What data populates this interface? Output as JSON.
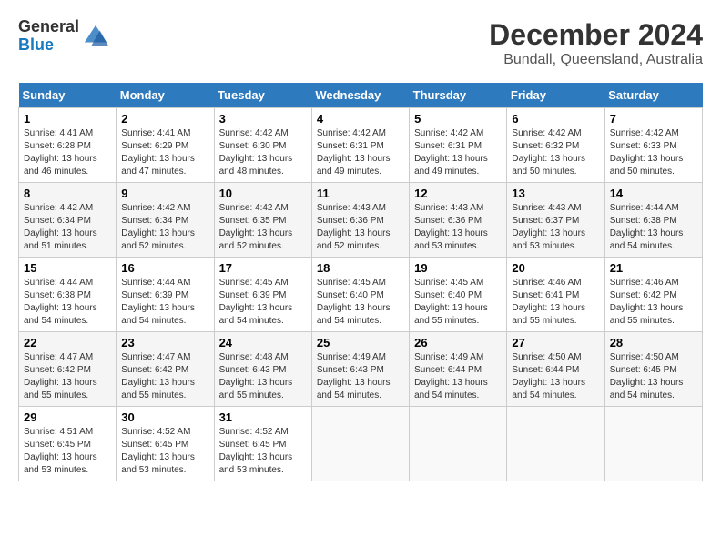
{
  "logo": {
    "general": "General",
    "blue": "Blue"
  },
  "title": "December 2024",
  "location": "Bundall, Queensland, Australia",
  "days_header": [
    "Sunday",
    "Monday",
    "Tuesday",
    "Wednesday",
    "Thursday",
    "Friday",
    "Saturday"
  ],
  "weeks": [
    [
      {
        "day": "1",
        "info": "Sunrise: 4:41 AM\nSunset: 6:28 PM\nDaylight: 13 hours\nand 46 minutes."
      },
      {
        "day": "2",
        "info": "Sunrise: 4:41 AM\nSunset: 6:29 PM\nDaylight: 13 hours\nand 47 minutes."
      },
      {
        "day": "3",
        "info": "Sunrise: 4:42 AM\nSunset: 6:30 PM\nDaylight: 13 hours\nand 48 minutes."
      },
      {
        "day": "4",
        "info": "Sunrise: 4:42 AM\nSunset: 6:31 PM\nDaylight: 13 hours\nand 49 minutes."
      },
      {
        "day": "5",
        "info": "Sunrise: 4:42 AM\nSunset: 6:31 PM\nDaylight: 13 hours\nand 49 minutes."
      },
      {
        "day": "6",
        "info": "Sunrise: 4:42 AM\nSunset: 6:32 PM\nDaylight: 13 hours\nand 50 minutes."
      },
      {
        "day": "7",
        "info": "Sunrise: 4:42 AM\nSunset: 6:33 PM\nDaylight: 13 hours\nand 50 minutes."
      }
    ],
    [
      {
        "day": "8",
        "info": "Sunrise: 4:42 AM\nSunset: 6:34 PM\nDaylight: 13 hours\nand 51 minutes."
      },
      {
        "day": "9",
        "info": "Sunrise: 4:42 AM\nSunset: 6:34 PM\nDaylight: 13 hours\nand 52 minutes."
      },
      {
        "day": "10",
        "info": "Sunrise: 4:42 AM\nSunset: 6:35 PM\nDaylight: 13 hours\nand 52 minutes."
      },
      {
        "day": "11",
        "info": "Sunrise: 4:43 AM\nSunset: 6:36 PM\nDaylight: 13 hours\nand 52 minutes."
      },
      {
        "day": "12",
        "info": "Sunrise: 4:43 AM\nSunset: 6:36 PM\nDaylight: 13 hours\nand 53 minutes."
      },
      {
        "day": "13",
        "info": "Sunrise: 4:43 AM\nSunset: 6:37 PM\nDaylight: 13 hours\nand 53 minutes."
      },
      {
        "day": "14",
        "info": "Sunrise: 4:44 AM\nSunset: 6:38 PM\nDaylight: 13 hours\nand 54 minutes."
      }
    ],
    [
      {
        "day": "15",
        "info": "Sunrise: 4:44 AM\nSunset: 6:38 PM\nDaylight: 13 hours\nand 54 minutes."
      },
      {
        "day": "16",
        "info": "Sunrise: 4:44 AM\nSunset: 6:39 PM\nDaylight: 13 hours\nand 54 minutes."
      },
      {
        "day": "17",
        "info": "Sunrise: 4:45 AM\nSunset: 6:39 PM\nDaylight: 13 hours\nand 54 minutes."
      },
      {
        "day": "18",
        "info": "Sunrise: 4:45 AM\nSunset: 6:40 PM\nDaylight: 13 hours\nand 54 minutes."
      },
      {
        "day": "19",
        "info": "Sunrise: 4:45 AM\nSunset: 6:40 PM\nDaylight: 13 hours\nand 55 minutes."
      },
      {
        "day": "20",
        "info": "Sunrise: 4:46 AM\nSunset: 6:41 PM\nDaylight: 13 hours\nand 55 minutes."
      },
      {
        "day": "21",
        "info": "Sunrise: 4:46 AM\nSunset: 6:42 PM\nDaylight: 13 hours\nand 55 minutes."
      }
    ],
    [
      {
        "day": "22",
        "info": "Sunrise: 4:47 AM\nSunset: 6:42 PM\nDaylight: 13 hours\nand 55 minutes."
      },
      {
        "day": "23",
        "info": "Sunrise: 4:47 AM\nSunset: 6:42 PM\nDaylight: 13 hours\nand 55 minutes."
      },
      {
        "day": "24",
        "info": "Sunrise: 4:48 AM\nSunset: 6:43 PM\nDaylight: 13 hours\nand 55 minutes."
      },
      {
        "day": "25",
        "info": "Sunrise: 4:49 AM\nSunset: 6:43 PM\nDaylight: 13 hours\nand 54 minutes."
      },
      {
        "day": "26",
        "info": "Sunrise: 4:49 AM\nSunset: 6:44 PM\nDaylight: 13 hours\nand 54 minutes."
      },
      {
        "day": "27",
        "info": "Sunrise: 4:50 AM\nSunset: 6:44 PM\nDaylight: 13 hours\nand 54 minutes."
      },
      {
        "day": "28",
        "info": "Sunrise: 4:50 AM\nSunset: 6:45 PM\nDaylight: 13 hours\nand 54 minutes."
      }
    ],
    [
      {
        "day": "29",
        "info": "Sunrise: 4:51 AM\nSunset: 6:45 PM\nDaylight: 13 hours\nand 53 minutes."
      },
      {
        "day": "30",
        "info": "Sunrise: 4:52 AM\nSunset: 6:45 PM\nDaylight: 13 hours\nand 53 minutes."
      },
      {
        "day": "31",
        "info": "Sunrise: 4:52 AM\nSunset: 6:45 PM\nDaylight: 13 hours\nand 53 minutes."
      },
      {
        "day": "",
        "info": ""
      },
      {
        "day": "",
        "info": ""
      },
      {
        "day": "",
        "info": ""
      },
      {
        "day": "",
        "info": ""
      }
    ]
  ]
}
